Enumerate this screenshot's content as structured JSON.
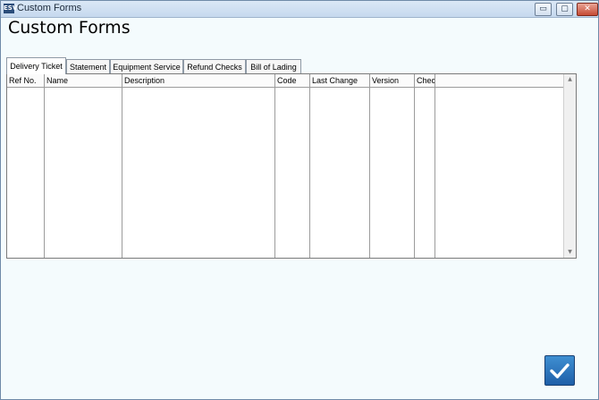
{
  "window": {
    "title": "Custom Forms",
    "icon": "app-logo-icon",
    "icon_text": "ESV",
    "controls": {
      "minimize": "▭",
      "maximize": "▢",
      "close": "✕"
    }
  },
  "page": {
    "title": "Custom Forms"
  },
  "tabs": [
    {
      "label": "Delivery Ticket",
      "active": true
    },
    {
      "label": "Statement",
      "active": false
    },
    {
      "label": "Equipment Service",
      "active": false
    },
    {
      "label": "Refund Checks",
      "active": false
    },
    {
      "label": "Bill of Lading",
      "active": false
    }
  ],
  "table": {
    "columns": [
      "Ref No.",
      "Name",
      "Description",
      "Code",
      "Last Change",
      "Version",
      "Chec",
      ""
    ],
    "rows": []
  },
  "actions": {
    "confirm_icon": "checkmark-icon"
  },
  "colors": {
    "accent": "#2a70bf",
    "background": "#f4fbfd"
  }
}
